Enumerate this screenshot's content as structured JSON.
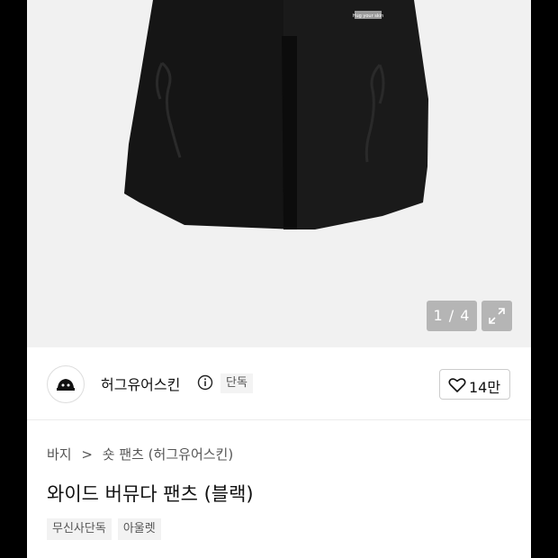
{
  "gallery": {
    "counter": "1 / 4",
    "expand_icon": "expand-icon",
    "garment_tag_text": "Hug your skin"
  },
  "brand": {
    "name": "허그유어스킨",
    "info_icon": "info-icon",
    "badge": "단독",
    "like_count": "14만",
    "logo_icon": "brand-logo-icon"
  },
  "breadcrumb": {
    "items": [
      "바지",
      "숏 팬츠 (허그유어스킨)"
    ],
    "separator": ">"
  },
  "product": {
    "title": "와이드 버뮤다 팬츠 (블랙)",
    "tags": [
      "무신사단독",
      "아울렛"
    ]
  },
  "colors": {
    "photo_bg": "#f1f1f1",
    "garment": "#151515",
    "tag_bg": "#f2f2f2"
  }
}
